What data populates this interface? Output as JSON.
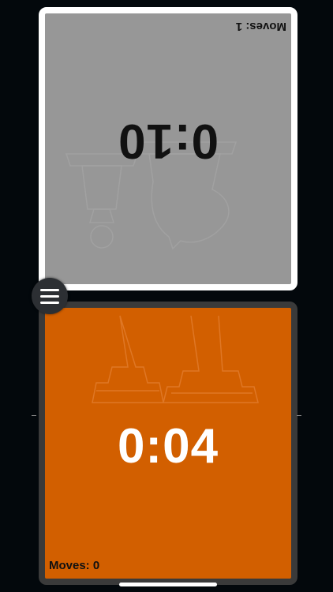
{
  "opponent": {
    "time": "0:10",
    "moves_label": "Moves: 1"
  },
  "player": {
    "time": "0:04",
    "moves_label": "Moves: 0"
  },
  "colors": {
    "background": "#03080c",
    "opponent_panel": "#979797",
    "opponent_border": "#ffffff",
    "player_panel": "#d25f00",
    "player_border": "#3a3a3a"
  },
  "icons": {
    "menu": "hamburger-menu-icon",
    "watermark": "chess-pieces-watermark"
  }
}
